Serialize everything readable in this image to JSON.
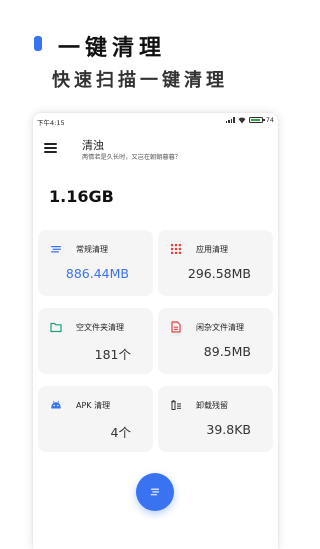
{
  "promo": {
    "title": "一键清理",
    "subtitle": "快速扫描一键清理"
  },
  "status_bar": {
    "time": "下午4:15",
    "battery": "74"
  },
  "app": {
    "title": "清浊",
    "subtitle": "两情若是久长时，又岂在朝朝暮暮？"
  },
  "summary": {
    "total": "1.16GB"
  },
  "cards": [
    {
      "label": "常规清理",
      "value": "886.44MB",
      "icon": "list-lines-icon"
    },
    {
      "label": "应用清理",
      "value": "296.58MB",
      "icon": "grid-dots-icon"
    },
    {
      "label": "空文件夹清理",
      "value": "181个",
      "icon": "folder-icon"
    },
    {
      "label": "闲杂文件清理",
      "value": "89.5MB",
      "icon": "document-icon"
    },
    {
      "label": "APK 清理",
      "value": "4个",
      "icon": "android-icon"
    },
    {
      "label": "卸载残留",
      "value": "39.8KB",
      "icon": "trash-list-icon"
    }
  ],
  "colors": {
    "accent": "#3a73f2",
    "grid_icon": "#e53e3e",
    "folder_icon": "#1f9d7a",
    "document_icon": "#e53e3e",
    "android_icon": "#3a73f2",
    "card_bg": "#f5f5f6"
  },
  "fab": {
    "icon": "clean-lines-icon"
  }
}
